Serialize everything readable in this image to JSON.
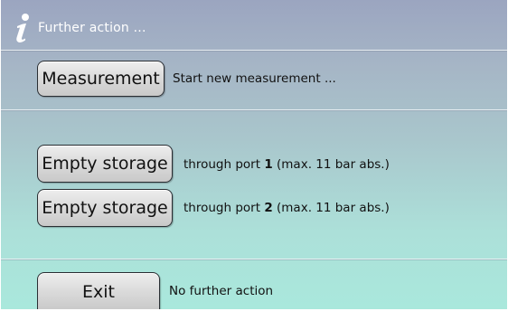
{
  "header": {
    "title": "Further action ...",
    "icon": "info-icon"
  },
  "actions": {
    "measurement": {
      "button_label": "Measurement",
      "description": "Start new measurement ..."
    },
    "empty_port1": {
      "button_label": "Empty storage",
      "desc_prefix": "through port ",
      "port": "1",
      "desc_suffix": " (max. 11 bar abs.)"
    },
    "empty_port2": {
      "button_label": "Empty storage",
      "desc_prefix": "through port ",
      "port": "2",
      "desc_suffix": " (max. 11 bar abs.)"
    },
    "exit": {
      "button_label": "Exit",
      "description": "No further action"
    }
  },
  "colors": {
    "title_text": "#ffffff",
    "button_border": "#2a2e33",
    "background_top": "#9ba5c0",
    "background_bottom": "#a9e8dc"
  }
}
